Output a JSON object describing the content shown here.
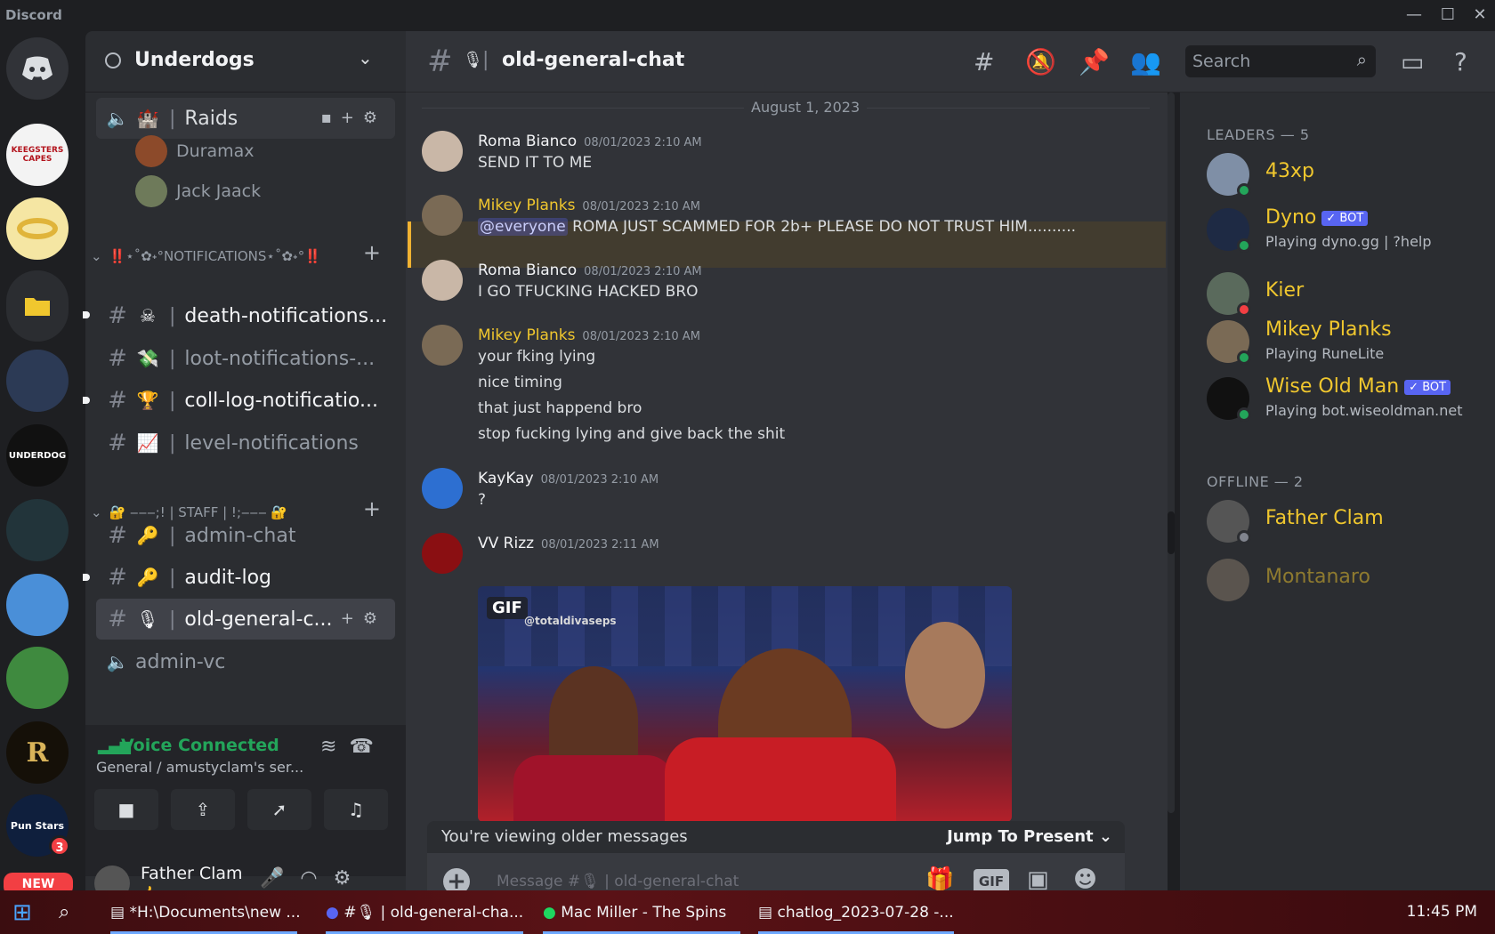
{
  "window": {
    "app_name": "Discord",
    "minimize": "—",
    "maximize": "☐",
    "close": "✕"
  },
  "rail": {
    "new_badge": "NEW",
    "mention_count": "3",
    "servers": [
      "KEEGSTERS CAPES",
      "UNDERDOG",
      "Pun Stars"
    ]
  },
  "server": {
    "name": "Underdogs"
  },
  "channels": {
    "raids": {
      "emoji": "🏰",
      "label": "Raids"
    },
    "voice_users": [
      "Duramax",
      "Jack Jaack"
    ],
    "cat_notifications": "‼️⋆˚✿˖°NOTIFICATIONS⋆˚✿˖°‼️",
    "death": {
      "emoji": "☠",
      "label": "death-notifications..."
    },
    "loot": {
      "emoji": "💸",
      "label": "loot-notifications-..."
    },
    "coll": {
      "emoji": "🏆",
      "label": "coll-log-notificatio..."
    },
    "level": {
      "emoji": "📈",
      "label": "level-notifications"
    },
    "cat_staff": "🔐 ‒‒‒;! | STAFF | !;‒‒‒ 🔐",
    "admin_chat": {
      "emoji": "🔑",
      "label": "admin-chat"
    },
    "audit_log": {
      "emoji": "🔑",
      "label": "audit-log"
    },
    "old_general": {
      "emoji": "🎙",
      "label": "old-general-c..."
    },
    "admin_vc": {
      "label": "admin-vc"
    }
  },
  "voice": {
    "status": "Voice Connected",
    "location": "General / amustyclam's ser..."
  },
  "user": {
    "name": "Father Clam",
    "status_emoji": "👍"
  },
  "header": {
    "channel_emoji": "🎙",
    "channel_name": "old-general-chat",
    "search_placeholder": "Search"
  },
  "chat": {
    "date_divider": "August 1, 2023",
    "messages": [
      {
        "author": "Roma Bianco",
        "time": "08/01/2023 2:10 AM",
        "lines": [
          "SEND IT TO ME"
        ]
      },
      {
        "author": "Mikey Planks",
        "time": "08/01/2023 2:10 AM",
        "mention": "@everyone",
        "lines": [
          "ROMA JUST SCAMMED FOR 2b+ PLEASE DO NOT TRUST HIM.........."
        ]
      },
      {
        "author": "Roma Bianco",
        "time": "08/01/2023 2:10 AM",
        "lines": [
          "I GO TFUCKING HACKED BRO"
        ]
      },
      {
        "author": "Mikey Planks",
        "time": "08/01/2023 2:10 AM",
        "lines": [
          "your fking lying",
          "nice timing",
          "that just happend bro",
          "stop fucking lying and give back the shit"
        ]
      },
      {
        "author": "KayKay",
        "time": "08/01/2023 2:10 AM",
        "lines": [
          "?"
        ]
      },
      {
        "author": "VV Rizz",
        "time": "08/01/2023 2:11 AM",
        "gif_tag": "GIF",
        "gif_credit": "@totaldivaseps"
      }
    ],
    "older_notice": "You're viewing older messages",
    "jump_label": "Jump To Present",
    "composer_placeholder": "Message #🎙 | old-general-chat",
    "gif_button": "GIF"
  },
  "members": {
    "leaders_header": "LEADERS — 5",
    "offline_header": "OFFLINE — 2",
    "leaders": [
      {
        "name": "43xp",
        "activity": "",
        "status": "online"
      },
      {
        "name": "Dyno",
        "bot": "✓ BOT",
        "activity": "Playing dyno.gg | ?help",
        "status": "online"
      },
      {
        "name": "Kier",
        "activity": "",
        "status": "dnd"
      },
      {
        "name": "Mikey Planks",
        "activity": "Playing RuneLite",
        "status": "online"
      },
      {
        "name": "Wise Old Man",
        "bot": "✓ BOT",
        "activity": "Playing bot.wiseoldman.net",
        "status": "online"
      }
    ],
    "offline": [
      {
        "name": "Father Clam"
      },
      {
        "name": "Montanaro"
      }
    ]
  },
  "taskbar": {
    "items": [
      "*H:\\Documents\\new ...",
      "#🎙 | old-general-cha...",
      "Mac Miller - The Spins",
      "chatlog_2023-07-28 -..."
    ],
    "clock": "11:45 PM"
  },
  "colors": {
    "accent_gold": "#f0c72e",
    "online": "#23a55a",
    "dnd": "#f23f43",
    "blurple": "#5865f2"
  }
}
